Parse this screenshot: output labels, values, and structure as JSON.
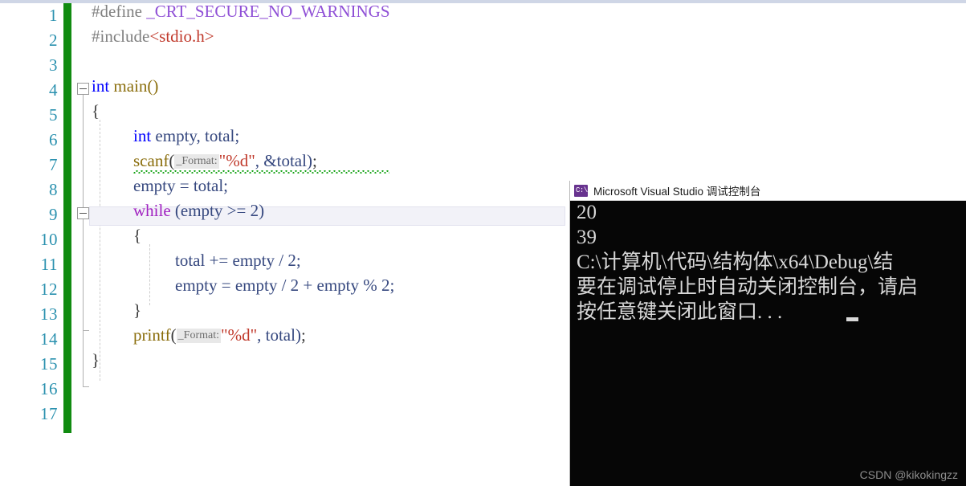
{
  "editor": {
    "line_numbers": [
      "1",
      "2",
      "3",
      "4",
      "5",
      "6",
      "7",
      "8",
      "9",
      "10",
      "11",
      "12",
      "13",
      "14",
      "15",
      "16",
      "17"
    ],
    "lines": [
      {
        "n": 1,
        "text": "#define _CRT_SECURE_NO_WARNINGS"
      },
      {
        "n": 2,
        "text": "#include<stdio.h>"
      },
      {
        "n": 3,
        "text": ""
      },
      {
        "n": 4,
        "text": "int main()"
      },
      {
        "n": 5,
        "text": "{"
      },
      {
        "n": 6,
        "text": "    int empty, total;"
      },
      {
        "n": 7,
        "text": "    scanf(_Format:\"%d\", &total);"
      },
      {
        "n": 8,
        "text": "    empty = total;"
      },
      {
        "n": 9,
        "text": "    while (empty >= 2)"
      },
      {
        "n": 10,
        "text": "    {"
      },
      {
        "n": 11,
        "text": "        total += empty / 2;"
      },
      {
        "n": 12,
        "text": "        empty = empty / 2 + empty % 2;"
      },
      {
        "n": 13,
        "text": "    }"
      },
      {
        "n": 14,
        "text": "    printf(_Format:\"%d\", total);"
      },
      {
        "n": 15,
        "text": "}"
      },
      {
        "n": 16,
        "text": ""
      },
      {
        "n": 17,
        "text": ""
      }
    ],
    "tokens": {
      "define_directive": "#define",
      "include_directive": "#include",
      "macro_name": " _CRT_SECURE_NO_WARNINGS",
      "include_target": "<stdio.h>",
      "kw_int": "int",
      "fn_main": " main()",
      "brace_open": "{",
      "brace_close": "}",
      "decl_rest": " empty, total;",
      "fn_scanf": "scanf",
      "fn_printf": "printf",
      "paren_open": "(",
      "hint_format": "_Format:",
      "fmt_string": "\"%d\"",
      "scanf_tail": ", &total)",
      "printf_tail": ", total)",
      "semicolon": ";",
      "assign_empty_total": "empty = total;",
      "kw_while": "while",
      "while_cond": " (empty >= 2)",
      "stmt_total_add": "total += empty / 2;",
      "stmt_empty_calc": "empty = empty / 2 + empty % 2;"
    },
    "colors": {
      "line_number": "#2b91af",
      "change_bar": "#108b10",
      "preprocessor": "#808080",
      "macro": "#8f4fd6",
      "string_red": "#c0392b",
      "keyword_blue": "#0000ff",
      "keyword_purple": "#a020c0",
      "identifier": "#36487f",
      "function": "#8a6d0b",
      "squiggle": "#17a317",
      "current_line_fill": "#f2f2f8"
    }
  },
  "console": {
    "title": "Microsoft Visual Studio 调试控制台",
    "icon": "console-cmd-icon",
    "icon_glyph": "C:\\",
    "output": [
      "20",
      "39",
      "C:\\计算机\\代码\\结构体\\x64\\Debug\\结",
      "要在调试停止时自动关闭控制台，请启",
      "按任意键关闭此窗口. . ."
    ],
    "cursor": "block"
  },
  "watermark": {
    "text": "CSDN @kikokingzz"
  }
}
